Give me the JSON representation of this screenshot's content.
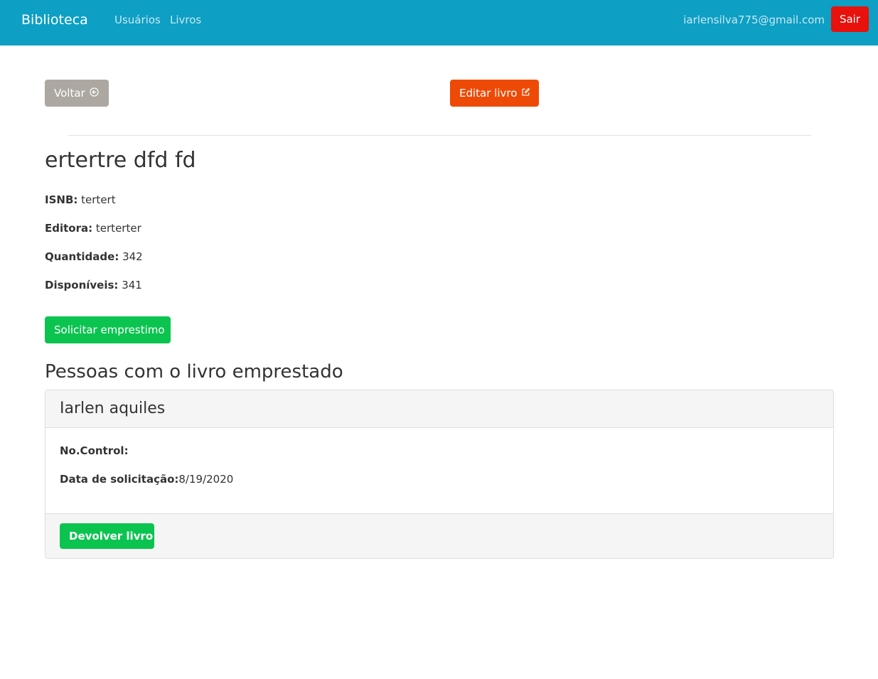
{
  "navbar": {
    "brand": "Biblioteca",
    "links": [
      "Usuários",
      "Livros"
    ],
    "user_email": "iarlensilva775@gmail.com",
    "logout_label": "Sair",
    "background_color": "#0d9fc4"
  },
  "actions": {
    "back_label": "Voltar",
    "back_icon": "circle-arrow-left-icon",
    "edit_label": "Editar livro",
    "edit_icon": "edit-square-icon"
  },
  "book": {
    "title": "ertertre dfd fd",
    "isbn_label": "ISNB:",
    "isbn_value": "tertert",
    "publisher_label": "Editora:",
    "publisher_value": "terterter",
    "quantity_label": "Quantidade:",
    "quantity_value": "342",
    "available_label": "Disponíveis:",
    "available_value": "341"
  },
  "request_loan_label": "Solicitar emprestimo",
  "borrowers_section": {
    "heading": "Pessoas com o livro emprestado",
    "borrowers": [
      {
        "name": "Iarlen aquiles",
        "control_label": "No.Control:",
        "control_value": "",
        "date_label": "Data de solicitação:",
        "date_value": "8/19/2020",
        "return_label": "Devolver livro"
      }
    ]
  },
  "colors": {
    "logout_button": "#e8110c",
    "back_button": "#aca7a0",
    "edit_button": "#ee4a07",
    "success_button": "#0bc450"
  }
}
